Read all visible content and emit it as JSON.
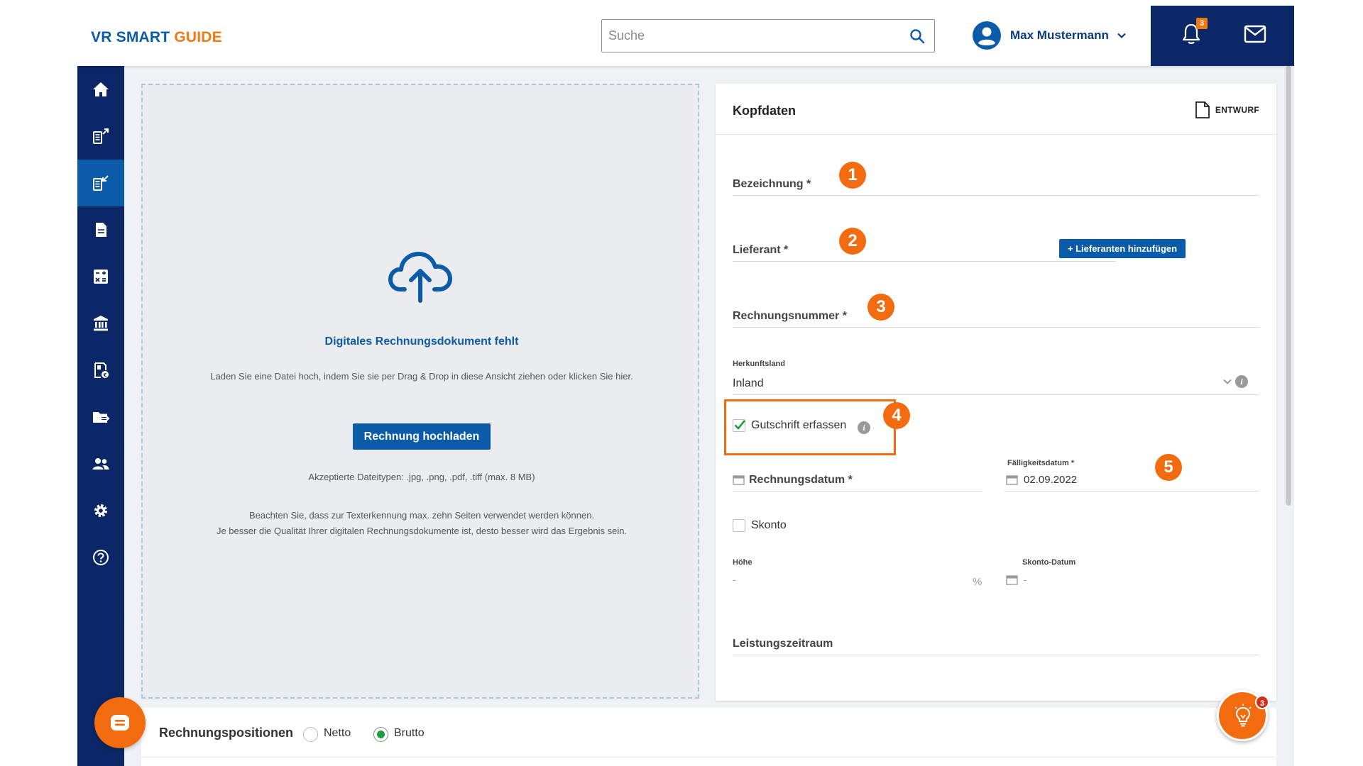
{
  "app": {
    "logo_vr": "VR SMART",
    "logo_guide": "GUIDE"
  },
  "header": {
    "search_placeholder": "Suche",
    "user_name": "Max Mustermann",
    "notification_count": "3"
  },
  "sidebar": {
    "items": [
      {
        "name": "home",
        "active": false
      },
      {
        "name": "outgoing-invoices",
        "active": false
      },
      {
        "name": "incoming-invoices",
        "active": true
      },
      {
        "name": "documents",
        "active": false
      },
      {
        "name": "accounting",
        "active": false
      },
      {
        "name": "bank",
        "active": false
      },
      {
        "name": "receipts",
        "active": false
      },
      {
        "name": "export",
        "active": false
      },
      {
        "name": "contacts",
        "active": false
      },
      {
        "name": "settings",
        "active": false
      },
      {
        "name": "help",
        "active": false
      }
    ]
  },
  "upload": {
    "title": "Digitales Rechnungsdokument fehlt",
    "description": "Laden Sie eine Datei hoch, indem Sie sie per Drag & Drop in diese Ansicht ziehen oder klicken Sie hier.",
    "button": "Rechnung hochladen",
    "accepted_types": "Akzeptierte Dateitypen: .jpg, .png, .pdf, .tiff (max. 8 MB)",
    "note_line1": "Beachten Sie, dass zur Texterkennung max. zehn Seiten verwendet werden können.",
    "note_line2": "Je besser die Qualität Ihrer digitalen Rechnungsdokumente ist, desto besser wird das Ergebnis sein."
  },
  "kopfdaten": {
    "title": "Kopfdaten",
    "status": "ENTWURF",
    "bezeichnung_label": "Bezeichnung *",
    "lieferant_label": "Lieferant *",
    "add_supplier_button": "+ Lieferanten hinzufügen",
    "rechnungsnummer_label": "Rechnungsnummer *",
    "herkunftsland_label": "Herkunftsland",
    "herkunftsland_value": "Inland",
    "gutschrift_label": "Gutschrift erfassen",
    "gutschrift_checked": true,
    "rechnungsdatum_label": "Rechnungsdatum *",
    "faelligkeitsdatum_label": "Fälligkeitsdatum *",
    "faelligkeitsdatum_value": "02.09.2022",
    "skonto_label": "Skonto",
    "hoehe_label": "Höhe",
    "hoehe_value": "-",
    "percent_sign": "%",
    "skonto_datum_label": "Skonto-Datum",
    "skonto_datum_value": "-",
    "leistungszeitraum_label": "Leistungszeitraum"
  },
  "markers": [
    "1",
    "2",
    "3",
    "4",
    "5"
  ],
  "positions": {
    "title": "Rechnungspositionen",
    "netto_label": "Netto",
    "brutto_label": "Brutto",
    "selected": "Brutto"
  },
  "help_badge": "3",
  "colors": {
    "navy": "#0c2768",
    "blue": "#0a5ca8",
    "orange": "#f26b0f",
    "green": "#1b9e3b"
  }
}
